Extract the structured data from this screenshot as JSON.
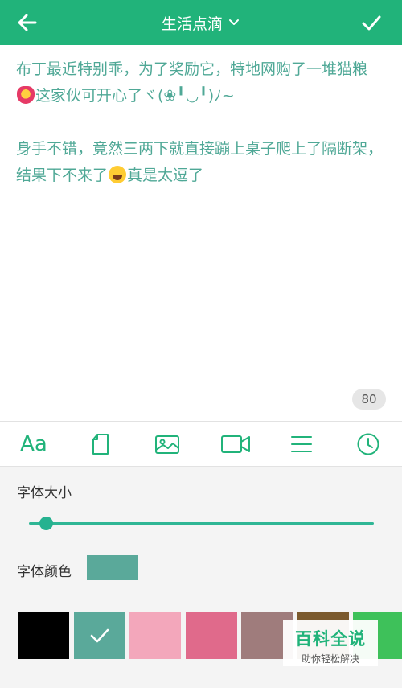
{
  "header": {
    "title": "生活点滴",
    "back_icon": "arrow-left-icon",
    "title_dropdown_icon": "chevron-down-icon",
    "confirm_icon": "checkmark-icon",
    "bar_color": "#21b37a"
  },
  "editor": {
    "paragraph1_part1": "布丁最近特别乖，为了奖励它，特地网购了一堆猫粮",
    "paragraph1_emoji": "gift-heart-emoji",
    "paragraph1_part2": "这家伙可开心了ヾ(❀╹◡╹)ﾉ~",
    "paragraph2_part1": "身手不错，竟然三两下就直接蹦上桌子爬上了隔断架，结果下不来了",
    "paragraph2_emoji": "tears-of-joy-emoji",
    "paragraph2_part2": "真是太逗了",
    "text_color": "#4fa896",
    "char_count": "80"
  },
  "toolbar": {
    "font_label": "Aa",
    "items": [
      "font-style-icon",
      "page-icon",
      "image-icon",
      "video-icon",
      "list-icon",
      "clock-icon"
    ],
    "accent_color": "#21b37a"
  },
  "font_panel": {
    "size_label": "字体大小",
    "size_level": 0.05,
    "color_label": "字体颜色",
    "selected_color": "#5aa99a",
    "swatches": [
      {
        "color": "#000000",
        "selected": false
      },
      {
        "color": "#5aa99a",
        "selected": true
      },
      {
        "color": "#f3a7bb",
        "selected": false
      },
      {
        "color": "#e06a8b",
        "selected": false
      },
      {
        "color": "#9f7c7c",
        "selected": false
      },
      {
        "color": "#7b5a2e",
        "selected": false
      },
      {
        "color": "#3ec15a",
        "selected": false
      }
    ]
  },
  "watermark": {
    "title": "百科全说",
    "subtitle": "助你轻松解决"
  }
}
